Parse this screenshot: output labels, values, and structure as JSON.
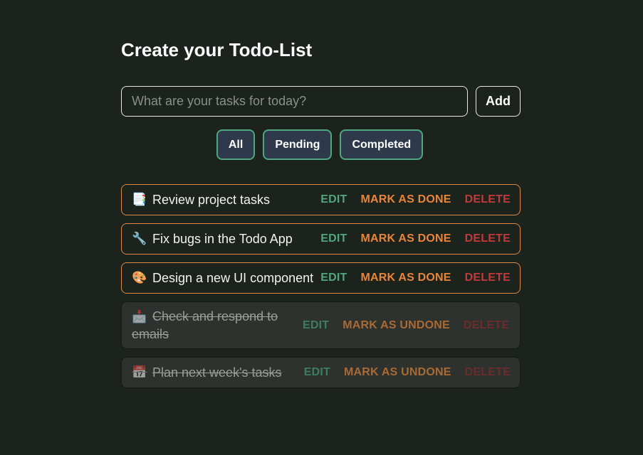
{
  "header": {
    "title": "Create your Todo-List"
  },
  "input": {
    "placeholder": "What are your tasks for today?",
    "value": ""
  },
  "add_button": {
    "label": "Add"
  },
  "filters": [
    {
      "label": "All"
    },
    {
      "label": "Pending"
    },
    {
      "label": "Completed"
    }
  ],
  "tasks": [
    {
      "emoji": "📑",
      "text": "Review project tasks",
      "done": false,
      "edit": "EDIT",
      "toggle": "MARK AS DONE",
      "delete": "DELETE"
    },
    {
      "emoji": "🔧",
      "text": "Fix bugs in the Todo App",
      "done": false,
      "edit": "EDIT",
      "toggle": "MARK AS DONE",
      "delete": "DELETE"
    },
    {
      "emoji": "🎨",
      "text": "Design a new UI component",
      "done": false,
      "edit": "EDIT",
      "toggle": "MARK AS DONE",
      "delete": "DELETE"
    },
    {
      "emoji": "📩",
      "text": "Check and respond to emails",
      "done": true,
      "edit": "EDIT",
      "toggle": "MARK AS UNDONE",
      "delete": "DELETE"
    },
    {
      "emoji": "📅",
      "text": "Plan next week's tasks",
      "done": true,
      "edit": "EDIT",
      "toggle": "MARK AS UNDONE",
      "delete": "DELETE"
    }
  ],
  "colors": {
    "background": "#1b231c",
    "accent_green": "#4fa67f",
    "accent_orange": "#e8853b",
    "accent_red": "#c0393b",
    "pending_border": "#d98b45",
    "filter_bg": "#2e3a4b"
  }
}
